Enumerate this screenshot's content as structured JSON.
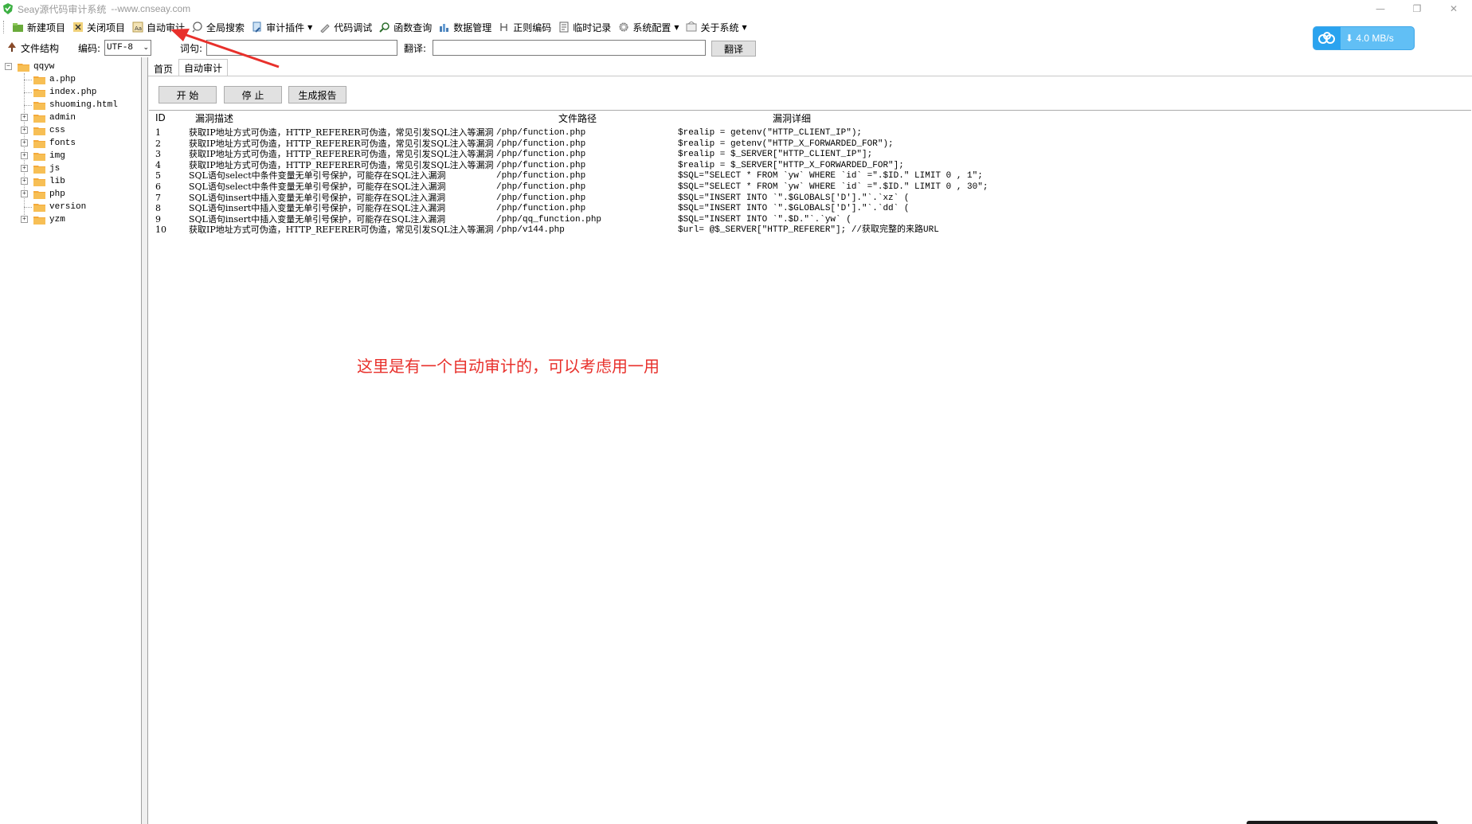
{
  "window": {
    "title": "Seay源代码审计系统",
    "site": "--www.cnseay.com"
  },
  "menu": [
    {
      "label": "新建项目",
      "icon": "new-project-icon"
    },
    {
      "label": "关闭项目",
      "icon": "close-project-icon"
    },
    {
      "label": "自动审计",
      "icon": "auto-audit-icon"
    },
    {
      "label": "全局搜索",
      "icon": "search-icon"
    },
    {
      "label": "审计插件",
      "icon": "plugin-icon"
    },
    {
      "label": "代码调试",
      "icon": "debug-icon"
    },
    {
      "label": "函数查询",
      "icon": "function-search-icon"
    },
    {
      "label": "数据管理",
      "icon": "database-icon"
    },
    {
      "label": "正则编码",
      "icon": "regex-icon"
    },
    {
      "label": "临时记录",
      "icon": "note-icon"
    },
    {
      "label": "系统配置",
      "icon": "gear-icon"
    },
    {
      "label": "关于系统",
      "icon": "about-icon"
    }
  ],
  "toolbar2": {
    "file_structure": "文件结构",
    "encoding_label": "编码:",
    "encoding_value": "UTF-8",
    "word_label": "词句:",
    "translate_label": "翻译:",
    "translate_button": "翻译"
  },
  "download": {
    "rate": "4.0 MB/s"
  },
  "tree": {
    "root": "qqyw",
    "items": [
      {
        "label": "a.php",
        "expandable": false
      },
      {
        "label": "index.php",
        "expandable": false
      },
      {
        "label": "shuoming.html",
        "expandable": false
      },
      {
        "label": "admin",
        "expandable": true
      },
      {
        "label": "css",
        "expandable": true
      },
      {
        "label": "fonts",
        "expandable": true
      },
      {
        "label": "img",
        "expandable": true
      },
      {
        "label": "js",
        "expandable": true
      },
      {
        "label": "lib",
        "expandable": true
      },
      {
        "label": "php",
        "expandable": true
      },
      {
        "label": "version",
        "expandable": false
      },
      {
        "label": "yzm",
        "expandable": true
      }
    ]
  },
  "tabs": [
    {
      "label": "首页"
    },
    {
      "label": "自动审计"
    }
  ],
  "actions": {
    "start": "开 始",
    "stop": "停 止",
    "report": "生成报告"
  },
  "results": {
    "columns": [
      "ID",
      "漏洞描述",
      "文件路径",
      "漏洞详细"
    ],
    "rows": [
      [
        "1",
        "获取IP地址方式可伪造，HTTP_REFERER可伪造，常见引发SQL注入等漏洞",
        "/php/function.php",
        "$realip = getenv(\"HTTP_CLIENT_IP\");"
      ],
      [
        "2",
        "获取IP地址方式可伪造，HTTP_REFERER可伪造，常见引发SQL注入等漏洞",
        "/php/function.php",
        "$realip = getenv(\"HTTP_X_FORWARDED_FOR\");"
      ],
      [
        "3",
        "获取IP地址方式可伪造，HTTP_REFERER可伪造，常见引发SQL注入等漏洞",
        "/php/function.php",
        "$realip = $_SERVER[\"HTTP_CLIENT_IP\"];"
      ],
      [
        "4",
        "获取IP地址方式可伪造，HTTP_REFERER可伪造，常见引发SQL注入等漏洞",
        "/php/function.php",
        "$realip = $_SERVER[\"HTTP_X_FORWARDED_FOR\"];"
      ],
      [
        "5",
        "SQL语句select中条件变量无单引号保护，可能存在SQL注入漏洞",
        "/php/function.php",
        "$SQL=\"SELECT * FROM  `yw` WHERE  `id` =\".$ID.\" LIMIT 0 , 1\";"
      ],
      [
        "6",
        "SQL语句select中条件变量无单引号保护，可能存在SQL注入漏洞",
        "/php/function.php",
        "$SQL=\"SELECT * FROM  `yw` WHERE  `id` =\".$ID.\" LIMIT 0 , 30\";"
      ],
      [
        "7",
        "SQL语句insert中插入变量无单引号保护，可能存在SQL注入漏洞",
        "/php/function.php",
        "$SQL=\"INSERT INTO  `\".$GLOBALS['D'].\"`.`xz` ("
      ],
      [
        "8",
        "SQL语句insert中插入变量无单引号保护，可能存在SQL注入漏洞",
        "/php/function.php",
        "$SQL=\"INSERT INTO  `\".$GLOBALS['D'].\"`.`dd` ("
      ],
      [
        "9",
        "SQL语句insert中插入变量无单引号保护，可能存在SQL注入漏洞",
        "/php/qq_function.php",
        "$SQL=\"INSERT INTO  `\".$D.\"`.`yw` ("
      ],
      [
        "10",
        "获取IP地址方式可伪造，HTTP_REFERER可伪造，常见引发SQL注入等漏洞",
        "/php/v144.php",
        "$url= @$_SERVER[\"HTTP_REFERER\"];   //获取完整的来路URL"
      ]
    ]
  },
  "annotation": {
    "text": "这里是有一个自动审计的，可以考虑用一用",
    "color": "#e8302b"
  },
  "colors": {
    "accent": "#e8302b",
    "badge": "#61bff5",
    "folder": "#f4a93a"
  }
}
